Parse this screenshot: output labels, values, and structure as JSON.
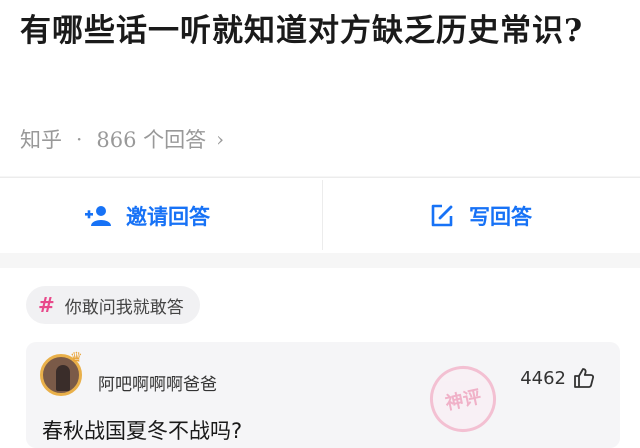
{
  "question": {
    "title": "有哪些话一听就知道对方缺乏历史常识?",
    "source": "知乎",
    "separator": "·",
    "answer_count": "866 个回答",
    "chevron_icon": "chevron-right-icon"
  },
  "actions": {
    "invite_label": "邀请回答",
    "invite_icon": "add-person-icon",
    "write_label": "写回答",
    "write_icon": "edit-icon",
    "accent_color": "#1772f6"
  },
  "topic_tag": {
    "hash": "#",
    "label": "你敢问我就敢答",
    "hash_color": "#e84a8b"
  },
  "answer": {
    "author": "阿吧啊啊啊爸爸",
    "avatar_icon": "avatar-icon",
    "crown_icon": "crown-icon",
    "likes": "4462",
    "like_icon": "thumbs-up-icon",
    "text": "春秋战国夏冬不战吗?",
    "stamp_text": "神评"
  }
}
